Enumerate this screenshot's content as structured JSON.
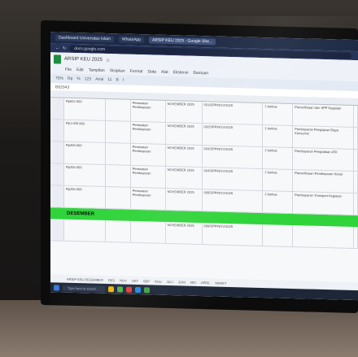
{
  "browser": {
    "tabs": [
      "Dashboard Universitas Islam",
      "WhatsApp",
      "ARSIP KEU 2025 - Google She..."
    ],
    "url": "docs.google.com"
  },
  "spreadsheet": {
    "title": "ARSIP KEU 2025",
    "menu": [
      "File",
      "Edit",
      "Tampilan",
      "Sisipkan",
      "Format",
      "Data",
      "Alat",
      "Ekstensi",
      "Bantuan"
    ],
    "toolbar": [
      "75%",
      "Rp",
      "%",
      "123",
      "Arial",
      "11",
      "B",
      "I"
    ],
    "cell_ref": "B62043",
    "banner_label": "DESEMBER",
    "rows": [
      {
        "c1": "Rp622.000",
        "c3": "Perawatan Pembayaran",
        "c4": "NOVEMBER 2025",
        "c5": "001/SPP/NOV/2025",
        "c6": "1 berkas",
        "c7": "Pemeriksaan dan SPP Kegiatan"
      },
      {
        "c1": "Rp1.000.000",
        "c3": "Perawatan Pembayaran",
        "c4": "NOVEMBER 2025",
        "c5": "002/SPP/NOV/2025",
        "c6": "1 berkas",
        "c7": "Pembayaran Pengajuan Biaya Konsumsi"
      },
      {
        "c1": "Rp400.000",
        "c3": "Perawatan Pembayaran",
        "c4": "NOVEMBER 2025",
        "c5": "003/SPP/NOV/2025",
        "c6": "1 berkas",
        "c7": "Pembayaran Pengadaan ATK"
      },
      {
        "c1": "Rp200.000",
        "c3": "Perawatan Pembayaran",
        "c4": "NOVEMBER 2025",
        "c5": "004/SPP/NOV/2025",
        "c6": "1 berkas",
        "c7": "Pemeriksaan Pembayaran Honor"
      },
      {
        "c1": "Rp200.000",
        "c3": "Perawatan Pembayaran",
        "c4": "NOVEMBER 2025",
        "c5": "005/SPP/NOV/2025",
        "c6": "1 berkas",
        "c7": "Pembayaran Transport Kegiatan"
      }
    ],
    "after_banner": {
      "c4": "NOVEMBER 2025",
      "c5": "006/SPP/NOV/2025"
    },
    "sheet_tabs": [
      "ARSIP KEU DESEMBER",
      "DES",
      "NOV",
      "OKT",
      "SEP",
      "AGU",
      "JULI",
      "JUNI",
      "MEI",
      "APRIL",
      "MARET"
    ],
    "taskbar_search": "Type here to search"
  },
  "colors": {
    "banner": "#2fd43a",
    "sheets_green": "#1e8e3e"
  }
}
